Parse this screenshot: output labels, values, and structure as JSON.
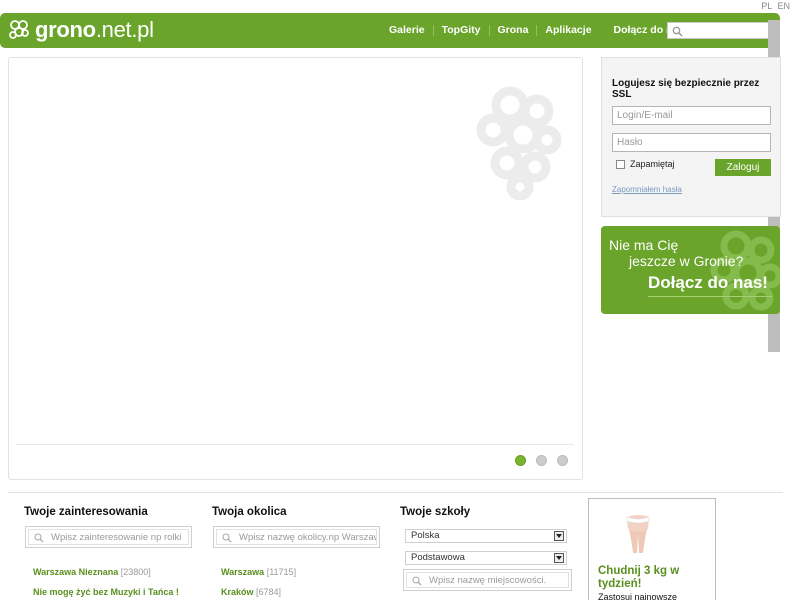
{
  "lang": [
    "PL",
    "EN"
  ],
  "header": {
    "logo_bold": "grono",
    "logo_rest": ".net.pl",
    "nav": [
      "Galerie",
      "TopGity",
      "Grona",
      "Aplikacje"
    ],
    "join_link": "Dołącz do nas!",
    "search_value": ""
  },
  "login": {
    "title": "Logujesz się bezpiecznie przez SSL",
    "login_placeholder": "Login/E-mail",
    "password_placeholder": "Hasło",
    "remember_label": "Zapamiętaj",
    "remember_checked": false,
    "submit_label": "Zaloguj",
    "forgot_label": "Zapomniałem hasła"
  },
  "join_box": {
    "line1": "Nie ma Cię",
    "line2": "jeszcze w Gronie?",
    "cta": "Dołącz do nas!"
  },
  "slider": {
    "pages": 3,
    "active_page": 1
  },
  "interests": {
    "title": "Twoje zainteresowania",
    "placeholder": "Wpisz zainteresowanie np rolki",
    "items": [
      {
        "name": "Warszawa Nieznana",
        "count": "[23800]"
      },
      {
        "name": "Nie mogę żyć bez Muzyki i Tańca !",
        "count": ""
      }
    ]
  },
  "neighborhood": {
    "title": "Twoja okolica",
    "placeholder": "Wpisz nazwę okolicy.np Warszawa",
    "items": [
      {
        "name": "Warszawa",
        "count": "[11715]"
      },
      {
        "name": "Kraków",
        "count": "[6784]"
      }
    ]
  },
  "schools": {
    "title": "Twoje szkoły",
    "country": "Polska",
    "level": "Podstawowa",
    "placeholder": "Wpisz nazwę miejscowości."
  },
  "ad": {
    "title": "Chudnij 3 kg w tydzień!",
    "text": "Zastosuj najnowsze"
  },
  "colors": {
    "brand_green": "#6aa42b",
    "link_green": "#5a8f1e",
    "forgot_link": "#7a9bc0"
  }
}
